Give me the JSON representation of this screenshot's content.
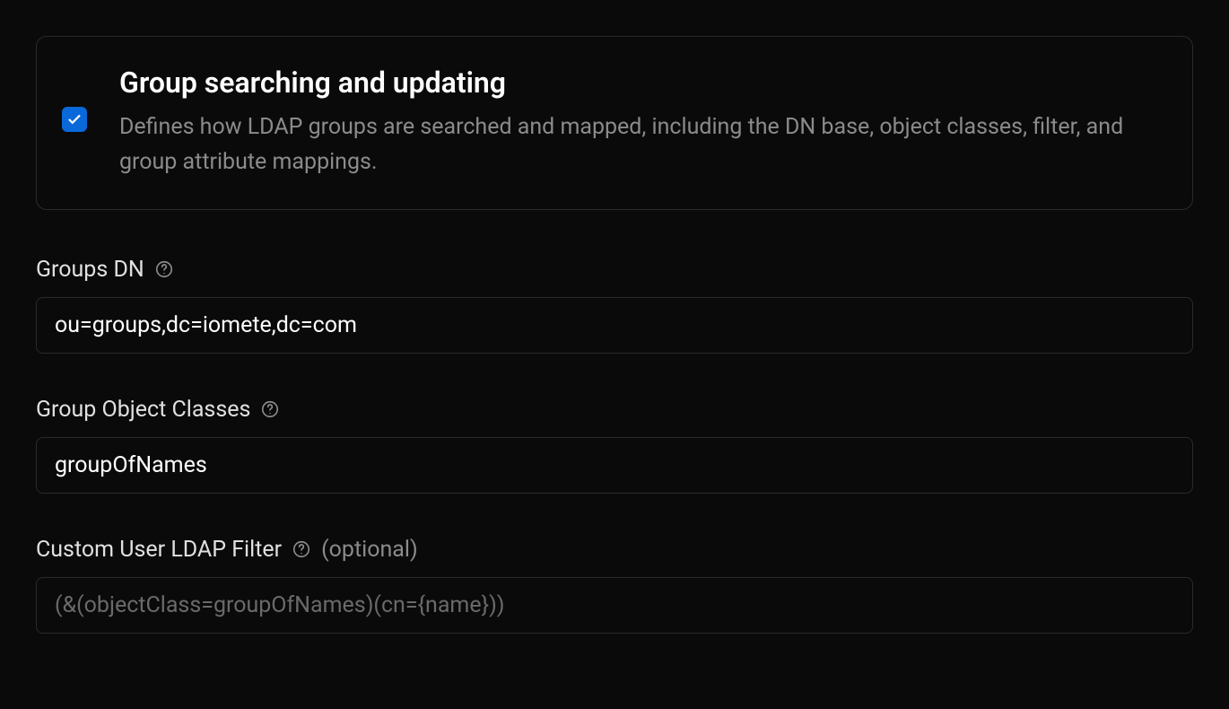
{
  "section": {
    "title": "Group searching and updating",
    "description": "Defines how LDAP groups are searched and mapped, including the DN base, object classes, filter, and group attribute mappings.",
    "checked": true
  },
  "fields": {
    "groupsDn": {
      "label": "Groups DN",
      "value": "ou=groups,dc=iomete,dc=com"
    },
    "groupObjectClasses": {
      "label": "Group Object Classes",
      "value": "groupOfNames"
    },
    "customFilter": {
      "label": "Custom User LDAP Filter",
      "optionalLabel": "(optional)",
      "value": "",
      "placeholder": "(&(objectClass=groupOfNames)(cn={name}))"
    }
  }
}
